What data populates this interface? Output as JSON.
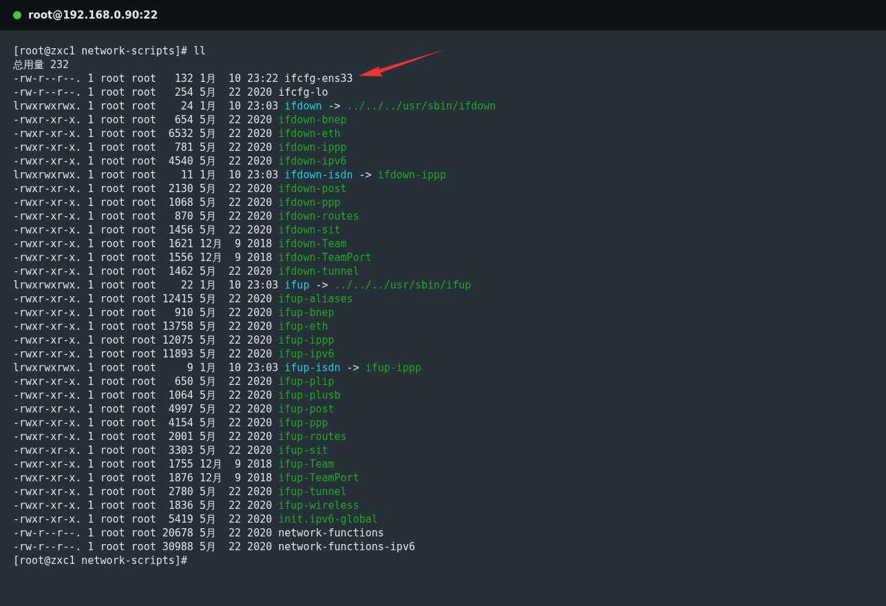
{
  "window": {
    "title": "root@192.168.0.90:22",
    "connected": true
  },
  "terminal": {
    "lines": [
      {
        "kind": "text",
        "text": "[root@zxc1 network-scripts]# ll"
      },
      {
        "kind": "text",
        "text": "总用量 232"
      },
      {
        "kind": "entry",
        "info": "-rw-r--r--. 1 root root   132 1月  10 23:22",
        "name": "ifcfg-ens33",
        "color": "#e2e2e2"
      },
      {
        "kind": "entry",
        "info": "-rw-r--r--. 1 root root   254 5月  22 2020",
        "name": "ifcfg-lo",
        "color": "#e2e2e2"
      },
      {
        "kind": "entry",
        "info": "lrwxrwxrwx. 1 root root    24 1月  10 23:03",
        "name": "ifdown",
        "color": "#1ad3e3",
        "arrow": "->",
        "target": {
          "text": "../../../usr/sbin/ifdown",
          "color": "#22a722"
        }
      },
      {
        "kind": "entry",
        "info": "-rwxr-xr-x. 1 root root   654 5月  22 2020",
        "name": "ifdown-bnep",
        "color": "#22a722"
      },
      {
        "kind": "entry",
        "info": "-rwxr-xr-x. 1 root root  6532 5月  22 2020",
        "name": "ifdown-eth",
        "color": "#22a722"
      },
      {
        "kind": "entry",
        "info": "-rwxr-xr-x. 1 root root   781 5月  22 2020",
        "name": "ifdown-ippp",
        "color": "#22a722"
      },
      {
        "kind": "entry",
        "info": "-rwxr-xr-x. 1 root root  4540 5月  22 2020",
        "name": "ifdown-ipv6",
        "color": "#22a722"
      },
      {
        "kind": "entry",
        "info": "lrwxrwxrwx. 1 root root    11 1月  10 23:03",
        "name": "ifdown-isdn",
        "color": "#1ad3e3",
        "arrow": "->",
        "target": {
          "text": "ifdown-ippp",
          "color": "#22a722"
        }
      },
      {
        "kind": "entry",
        "info": "-rwxr-xr-x. 1 root root  2130 5月  22 2020",
        "name": "ifdown-post",
        "color": "#22a722"
      },
      {
        "kind": "entry",
        "info": "-rwxr-xr-x. 1 root root  1068 5月  22 2020",
        "name": "ifdown-ppp",
        "color": "#22a722"
      },
      {
        "kind": "entry",
        "info": "-rwxr-xr-x. 1 root root   870 5月  22 2020",
        "name": "ifdown-routes",
        "color": "#22a722"
      },
      {
        "kind": "entry",
        "info": "-rwxr-xr-x. 1 root root  1456 5月  22 2020",
        "name": "ifdown-sit",
        "color": "#22a722"
      },
      {
        "kind": "entry",
        "info": "-rwxr-xr-x. 1 root root  1621 12月  9 2018",
        "name": "ifdown-Team",
        "color": "#22a722"
      },
      {
        "kind": "entry",
        "info": "-rwxr-xr-x. 1 root root  1556 12月  9 2018",
        "name": "ifdown-TeamPort",
        "color": "#22a722"
      },
      {
        "kind": "entry",
        "info": "-rwxr-xr-x. 1 root root  1462 5月  22 2020",
        "name": "ifdown-tunnel",
        "color": "#22a722"
      },
      {
        "kind": "entry",
        "info": "lrwxrwxrwx. 1 root root    22 1月  10 23:03",
        "name": "ifup",
        "color": "#1ad3e3",
        "arrow": "->",
        "target": {
          "text": "../../../usr/sbin/ifup",
          "color": "#22a722"
        }
      },
      {
        "kind": "entry",
        "info": "-rwxr-xr-x. 1 root root 12415 5月  22 2020",
        "name": "ifup-aliases",
        "color": "#22a722"
      },
      {
        "kind": "entry",
        "info": "-rwxr-xr-x. 1 root root   910 5月  22 2020",
        "name": "ifup-bnep",
        "color": "#22a722"
      },
      {
        "kind": "entry",
        "info": "-rwxr-xr-x. 1 root root 13758 5月  22 2020",
        "name": "ifup-eth",
        "color": "#22a722"
      },
      {
        "kind": "entry",
        "info": "-rwxr-xr-x. 1 root root 12075 5月  22 2020",
        "name": "ifup-ippp",
        "color": "#22a722"
      },
      {
        "kind": "entry",
        "info": "-rwxr-xr-x. 1 root root 11893 5月  22 2020",
        "name": "ifup-ipv6",
        "color": "#22a722"
      },
      {
        "kind": "entry",
        "info": "lrwxrwxrwx. 1 root root     9 1月  10 23:03",
        "name": "ifup-isdn",
        "color": "#1ad3e3",
        "arrow": "->",
        "target": {
          "text": "ifup-ippp",
          "color": "#22a722"
        }
      },
      {
        "kind": "entry",
        "info": "-rwxr-xr-x. 1 root root   650 5月  22 2020",
        "name": "ifup-plip",
        "color": "#22a722"
      },
      {
        "kind": "entry",
        "info": "-rwxr-xr-x. 1 root root  1064 5月  22 2020",
        "name": "ifup-plusb",
        "color": "#22a722"
      },
      {
        "kind": "entry",
        "info": "-rwxr-xr-x. 1 root root  4997 5月  22 2020",
        "name": "ifup-post",
        "color": "#22a722"
      },
      {
        "kind": "entry",
        "info": "-rwxr-xr-x. 1 root root  4154 5月  22 2020",
        "name": "ifup-ppp",
        "color": "#22a722"
      },
      {
        "kind": "entry",
        "info": "-rwxr-xr-x. 1 root root  2001 5月  22 2020",
        "name": "ifup-routes",
        "color": "#22a722"
      },
      {
        "kind": "entry",
        "info": "-rwxr-xr-x. 1 root root  3303 5月  22 2020",
        "name": "ifup-sit",
        "color": "#22a722"
      },
      {
        "kind": "entry",
        "info": "-rwxr-xr-x. 1 root root  1755 12月  9 2018",
        "name": "ifup-Team",
        "color": "#22a722"
      },
      {
        "kind": "entry",
        "info": "-rwxr-xr-x. 1 root root  1876 12月  9 2018",
        "name": "ifup-TeamPort",
        "color": "#22a722"
      },
      {
        "kind": "entry",
        "info": "-rwxr-xr-x. 1 root root  2780 5月  22 2020",
        "name": "ifup-tunnel",
        "color": "#22a722"
      },
      {
        "kind": "entry",
        "info": "-rwxr-xr-x. 1 root root  1836 5月  22 2020",
        "name": "ifup-wireless",
        "color": "#22a722"
      },
      {
        "kind": "entry",
        "info": "-rwxr-xr-x. 1 root root  5419 5月  22 2020",
        "name": "init.ipv6-global",
        "color": "#22a722"
      },
      {
        "kind": "entry",
        "info": "-rw-r--r--. 1 root root 20678 5月  22 2020",
        "name": "network-functions",
        "color": "#e2e2e2"
      },
      {
        "kind": "entry",
        "info": "-rw-r--r--. 1 root root 30988 5月  22 2020",
        "name": "network-functions-ipv6",
        "color": "#e2e2e2"
      },
      {
        "kind": "text",
        "text": "[root@zxc1 network-scripts]#"
      }
    ]
  }
}
